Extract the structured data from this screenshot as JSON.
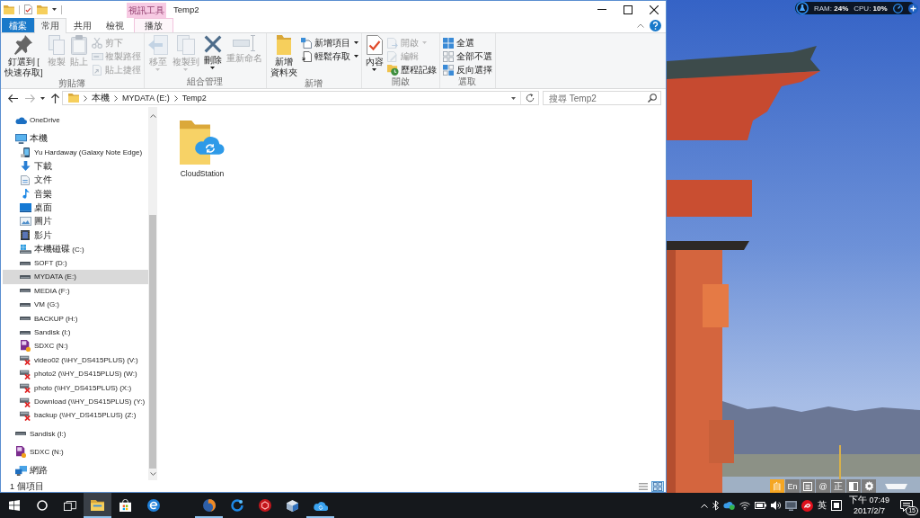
{
  "window": {
    "title": "Temp2",
    "contextual_tab_group": "視訊工具"
  },
  "ribbon_tabs": [
    {
      "label": "檔案",
      "kind": "file",
      "selected": false
    },
    {
      "label": "常用",
      "kind": "standard",
      "selected": true
    },
    {
      "label": "共用",
      "kind": "standard",
      "selected": false
    },
    {
      "label": "檢視",
      "kind": "standard",
      "selected": false
    },
    {
      "label": "播放",
      "kind": "contextual",
      "selected": false
    }
  ],
  "ribbon_groups": [
    {
      "label": "剪貼簿",
      "commands": [
        {
          "lines": [
            "釘選到 [",
            "快速存取]"
          ],
          "kind": "large",
          "disabled": false,
          "dropdown": false
        },
        {
          "lines": [
            "複製"
          ],
          "kind": "large",
          "disabled": true,
          "dropdown": false
        },
        {
          "lines": [
            "貼上"
          ],
          "kind": "large",
          "disabled": true,
          "dropdown": false
        },
        {
          "label": "剪下",
          "kind": "small",
          "disabled": true,
          "dropdown": false
        },
        {
          "label": "複製路徑",
          "kind": "small",
          "disabled": true,
          "dropdown": false
        },
        {
          "label": "貼上捷徑",
          "kind": "small",
          "disabled": true,
          "dropdown": false
        }
      ]
    },
    {
      "label": "組合管理",
      "commands": [
        {
          "lines": [
            "移至"
          ],
          "kind": "large",
          "disabled": true,
          "dropdown": true
        },
        {
          "lines": [
            "複製到"
          ],
          "kind": "large",
          "disabled": true,
          "dropdown": true
        },
        {
          "lines": [
            "刪除"
          ],
          "kind": "large",
          "disabled": false,
          "dropdown": true
        },
        {
          "lines": [
            "重新命名"
          ],
          "kind": "large",
          "disabled": true,
          "dropdown": false
        }
      ]
    },
    {
      "label": "新增",
      "commands": [
        {
          "lines": [
            "新增",
            "資料夾"
          ],
          "kind": "large",
          "disabled": false,
          "dropdown": false
        },
        {
          "label": "新增項目",
          "kind": "small",
          "disabled": false,
          "dropdown": true
        },
        {
          "label": "輕鬆存取",
          "kind": "small",
          "disabled": false,
          "dropdown": true
        }
      ]
    },
    {
      "label": "開啟",
      "commands": [
        {
          "lines": [
            "內容"
          ],
          "kind": "large",
          "disabled": false,
          "dropdown": true
        },
        {
          "label": "開啟",
          "kind": "small",
          "disabled": true,
          "dropdown": true
        },
        {
          "label": "編輯",
          "kind": "small",
          "disabled": true,
          "dropdown": false
        },
        {
          "label": "歷程記錄",
          "kind": "small",
          "disabled": false,
          "dropdown": false
        }
      ]
    },
    {
      "label": "選取",
      "commands": [
        {
          "label": "全選",
          "kind": "small",
          "disabled": false,
          "dropdown": false
        },
        {
          "label": "全部不選",
          "kind": "small",
          "disabled": false,
          "dropdown": false
        },
        {
          "label": "反向選擇",
          "kind": "small",
          "disabled": false,
          "dropdown": false
        }
      ]
    }
  ],
  "address": {
    "breadcrumb": [
      "本機",
      "MYDATA (E:)",
      "Temp2"
    ]
  },
  "search": {
    "placeholder": "搜尋 Temp2"
  },
  "navigation_pane": {
    "items": [
      {
        "label": "OneDrive",
        "kind": "onedrive",
        "selected": false
      },
      {
        "label": "本機",
        "kind": "pc",
        "selected": false,
        "children": [
          {
            "label": "Yu Hardaway (Galaxy Note Edge)",
            "kind": "phone",
            "selected": false
          },
          {
            "label": "下載",
            "kind": "downloads",
            "selected": false
          },
          {
            "label": "文件",
            "kind": "documents",
            "selected": false
          },
          {
            "label": "音樂",
            "kind": "music",
            "selected": false
          },
          {
            "label": "桌面",
            "kind": "desktop",
            "selected": false
          },
          {
            "label": "圖片",
            "kind": "pictures",
            "selected": false
          },
          {
            "label": "影片",
            "kind": "videos",
            "selected": false
          },
          {
            "label": "本機磁碟 (C:)",
            "kind": "system",
            "selected": false
          },
          {
            "label": "SOFT (D:)",
            "kind": "drive",
            "selected": false
          },
          {
            "label": "MYDATA (E:)",
            "kind": "drive",
            "selected": true
          },
          {
            "label": "MEDIA (F:)",
            "kind": "drive",
            "selected": false
          },
          {
            "label": "VM (G:)",
            "kind": "drive",
            "selected": false
          },
          {
            "label": "BACKUP (H:)",
            "kind": "drive",
            "selected": false
          },
          {
            "label": "Sandisk (I:)",
            "kind": "drive",
            "selected": false
          },
          {
            "label": "SDXC (N:)",
            "kind": "sdcard",
            "selected": false
          },
          {
            "label": "video02 (\\\\HY_DS415PLUS) (V:)",
            "kind": "netdrive",
            "selected": false
          },
          {
            "label": "photo2 (\\\\HY_DS415PLUS) (W:)",
            "kind": "netdrive",
            "selected": false
          },
          {
            "label": "photo (\\\\HY_DS415PLUS) (X:)",
            "kind": "netdrive",
            "selected": false
          },
          {
            "label": "Download (\\\\HY_DS415PLUS) (Y:)",
            "kind": "netdrive",
            "selected": false
          },
          {
            "label": "backup (\\\\HY_DS415PLUS) (Z:)",
            "kind": "netdrive",
            "selected": false
          }
        ]
      },
      {
        "label": "Sandisk (I:)",
        "kind": "drive",
        "selected": false
      },
      {
        "label": "SDXC (N:)",
        "kind": "sdcard",
        "selected": false
      },
      {
        "label": "網路",
        "kind": "network",
        "selected": false
      }
    ]
  },
  "files": [
    {
      "name": "CloudStation"
    }
  ],
  "status_bar": {
    "item_count": "1 個項目",
    "views": [
      {
        "kind": "details",
        "selected": false
      },
      {
        "kind": "large_icons",
        "selected": true
      }
    ]
  },
  "system_monitor": {
    "ram": "RAM: **24%**",
    "cpu": "CPU: **10%**"
  },
  "ime_toolbar": {
    "buttons": [
      {
        "kind": "text",
        "label": "自",
        "selected": true
      },
      {
        "kind": "text",
        "label": "En",
        "selected": false
      },
      {
        "kind": "list",
        "selected": false
      },
      {
        "kind": "text",
        "label": "@",
        "selected": false
      },
      {
        "kind": "text",
        "label": "正",
        "selected": false
      },
      {
        "kind": "contrast",
        "selected": false
      },
      {
        "kind": "settings",
        "selected": false
      }
    ]
  },
  "taskbar": {
    "apps": [
      {
        "open": true,
        "active": true
      },
      {
        "open": false,
        "active": false
      },
      {
        "open": false,
        "active": false
      },
      {
        "open": true,
        "active": false
      },
      {
        "open": false,
        "active": false
      },
      {
        "open": false,
        "active": false
      },
      {
        "open": false,
        "active": false
      },
      {
        "open": true,
        "active": false
      }
    ],
    "input_language": "英",
    "time": "下午 07:49",
    "date": "2017/2/7",
    "notification_count": "15"
  }
}
